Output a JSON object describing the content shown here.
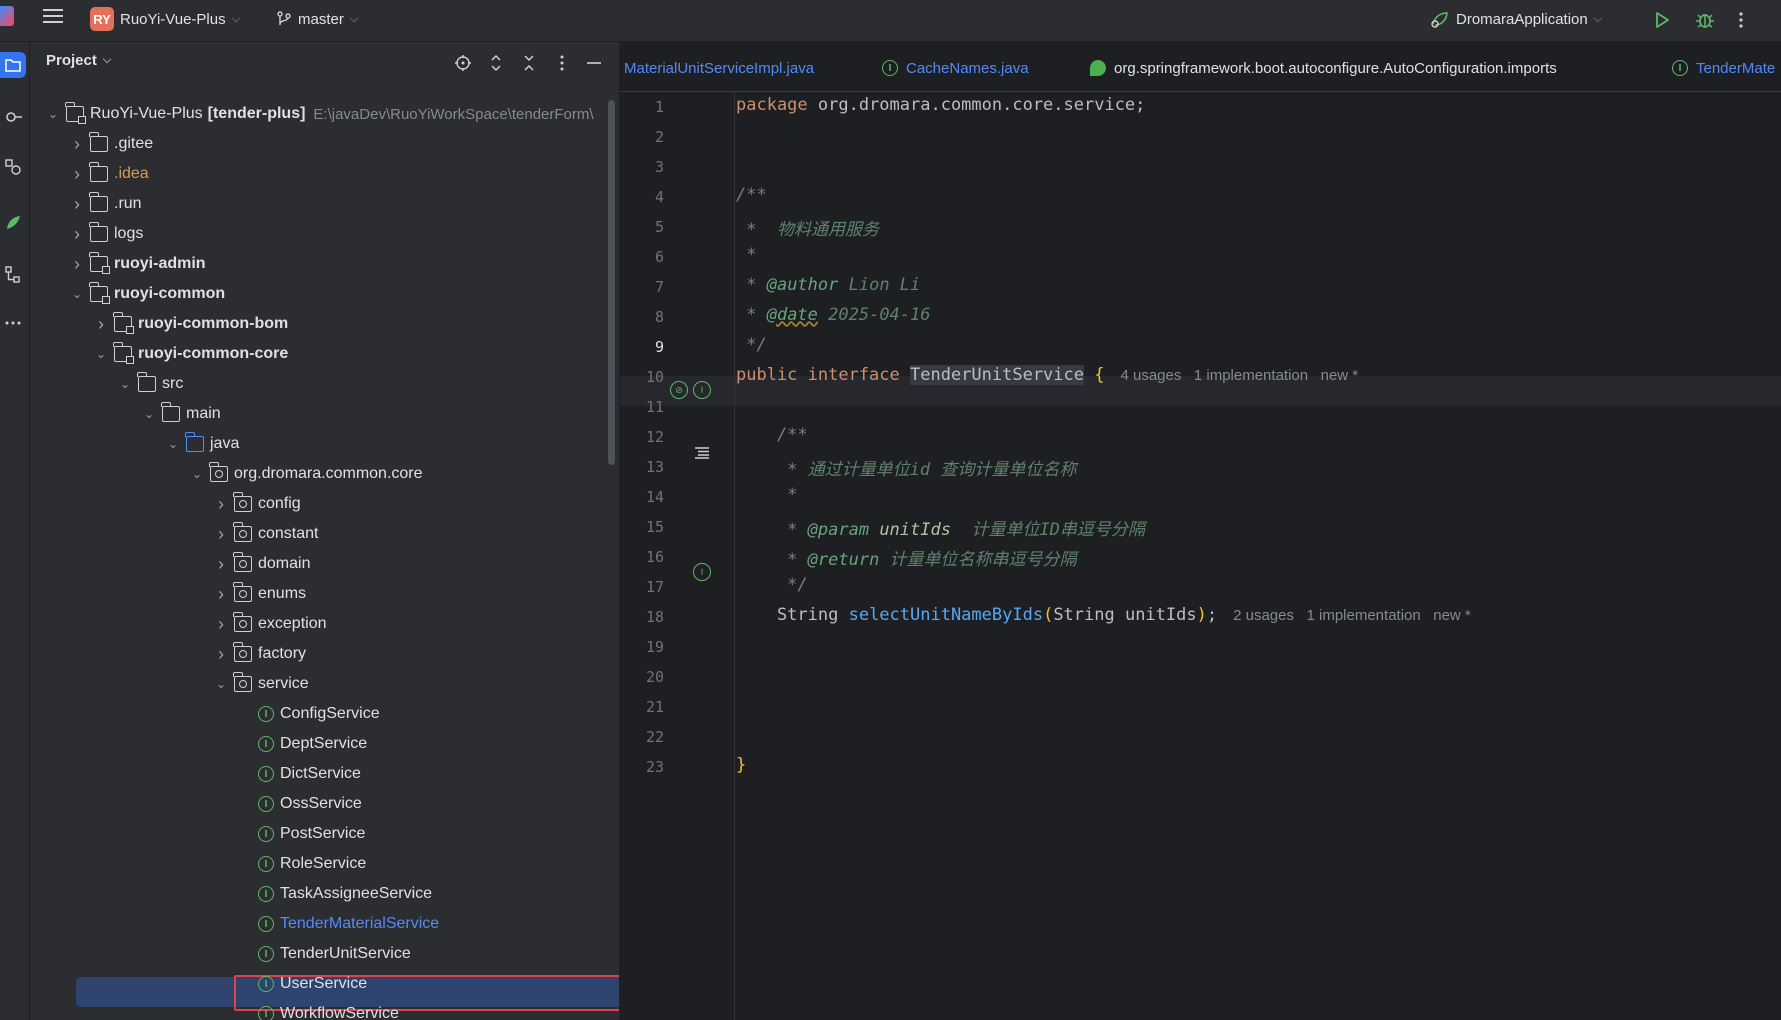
{
  "titlebar": {
    "project_badge": "RY",
    "project_name": "RuoYi-Vue-Plus",
    "branch": "master",
    "run_config": "DromaraApplication"
  },
  "project_panel": {
    "title": "Project",
    "root": {
      "name": "RuoYi-Vue-Plus",
      "module": "[tender-plus]",
      "path": "E:\\javaDev\\RuoYiWorkSpace\\tenderForm\\"
    },
    "tree": [
      {
        "label": ".gitee",
        "depth": 1,
        "expanded": false,
        "kind": "folder"
      },
      {
        "label": ".idea",
        "depth": 1,
        "expanded": false,
        "kind": "folder",
        "color": "orange"
      },
      {
        "label": ".run",
        "depth": 1,
        "expanded": false,
        "kind": "folder"
      },
      {
        "label": "logs",
        "depth": 1,
        "expanded": false,
        "kind": "folder"
      },
      {
        "label": "ruoyi-admin",
        "depth": 1,
        "expanded": false,
        "kind": "module",
        "bold": true
      },
      {
        "label": "ruoyi-common",
        "depth": 1,
        "expanded": true,
        "kind": "module",
        "bold": true
      },
      {
        "label": "ruoyi-common-bom",
        "depth": 2,
        "expanded": false,
        "kind": "module",
        "bold": true
      },
      {
        "label": "ruoyi-common-core",
        "depth": 2,
        "expanded": true,
        "kind": "module",
        "bold": true
      },
      {
        "label": "src",
        "depth": 3,
        "expanded": true,
        "kind": "folder"
      },
      {
        "label": "main",
        "depth": 4,
        "expanded": true,
        "kind": "folder"
      },
      {
        "label": "java",
        "depth": 5,
        "expanded": true,
        "kind": "blue"
      },
      {
        "label": "org.dromara.common.core",
        "depth": 6,
        "expanded": true,
        "kind": "pkg"
      },
      {
        "label": "config",
        "depth": 7,
        "expanded": false,
        "kind": "pkg"
      },
      {
        "label": "constant",
        "depth": 7,
        "expanded": false,
        "kind": "pkg"
      },
      {
        "label": "domain",
        "depth": 7,
        "expanded": false,
        "kind": "pkg"
      },
      {
        "label": "enums",
        "depth": 7,
        "expanded": false,
        "kind": "pkg"
      },
      {
        "label": "exception",
        "depth": 7,
        "expanded": false,
        "kind": "pkg"
      },
      {
        "label": "factory",
        "depth": 7,
        "expanded": false,
        "kind": "pkg"
      },
      {
        "label": "service",
        "depth": 7,
        "expanded": true,
        "kind": "pkg"
      },
      {
        "label": "ConfigService",
        "depth": 8,
        "kind": "iface"
      },
      {
        "label": "DeptService",
        "depth": 8,
        "kind": "iface"
      },
      {
        "label": "DictService",
        "depth": 8,
        "kind": "iface"
      },
      {
        "label": "OssService",
        "depth": 8,
        "kind": "iface"
      },
      {
        "label": "PostService",
        "depth": 8,
        "kind": "iface"
      },
      {
        "label": "RoleService",
        "depth": 8,
        "kind": "iface"
      },
      {
        "label": "TaskAssigneeService",
        "depth": 8,
        "kind": "iface"
      },
      {
        "label": "TenderMaterialService",
        "depth": 8,
        "kind": "iface",
        "color": "blue"
      },
      {
        "label": "TenderUnitService",
        "depth": 8,
        "kind": "iface",
        "selected": true
      },
      {
        "label": "UserService",
        "depth": 8,
        "kind": "iface"
      },
      {
        "label": "WorkflowService",
        "depth": 8,
        "kind": "iface"
      }
    ]
  },
  "editor": {
    "tabs": [
      {
        "label": "MaterialUnitServiceImpl.java",
        "icon": "none"
      },
      {
        "label": "CacheNames.java",
        "icon": "interface-icon"
      },
      {
        "label": "org.springframework.boot.autoconfigure.AutoConfiguration.imports",
        "icon": "spring-icon"
      },
      {
        "label": "TenderMate",
        "icon": "interface-icon"
      }
    ],
    "line_numbers": [
      "1",
      "2",
      "3",
      "4",
      "5",
      "6",
      "7",
      "8",
      "9",
      "10",
      "11",
      "12",
      "13",
      "14",
      "15",
      "16",
      "17",
      "18",
      "19",
      "20",
      "21",
      "22",
      "23"
    ],
    "code": {
      "l1_kw": "package",
      "l1_rest": " org.dromara.common.core.service;",
      "l3": "/**",
      "l4_star": " *  ",
      "l4_text": "物料通用服务",
      "l5": " *",
      "l6_star": " * ",
      "l6_tag": "@author",
      "l6_val": " Lion Li",
      "l7_star": " * ",
      "l7_tag": "@date",
      "l7_val": " 2025-04-16",
      "l8": " */",
      "l9_kw": "public interface ",
      "l9_name": "TenderUnitService",
      "l9_brace": " {",
      "l9_hint": "4 usages   1 implementation   new *",
      "l11": "    /**",
      "l12_star": "     * ",
      "l12_text": "通过计量单位id 查询计量单位名称",
      "l13": "     *",
      "l14_star": "     * ",
      "l14_tag": "@param",
      "l14_param": " unitIds",
      "l14_text": "  计量单位ID串逗号分隔",
      "l15_star": "     * ",
      "l15_tag": "@return",
      "l15_text": " 计量单位名称串逗号分隔",
      "l16": "     */",
      "l17_type": "    String ",
      "l17_fn": "selectUnitNameByIds",
      "l17_open": "(",
      "l17_args": "String unitIds",
      "l17_close": ")",
      "l17_semi": ";",
      "l17_hint": "2 usages   1 implementation   new *",
      "l22": "}"
    }
  }
}
